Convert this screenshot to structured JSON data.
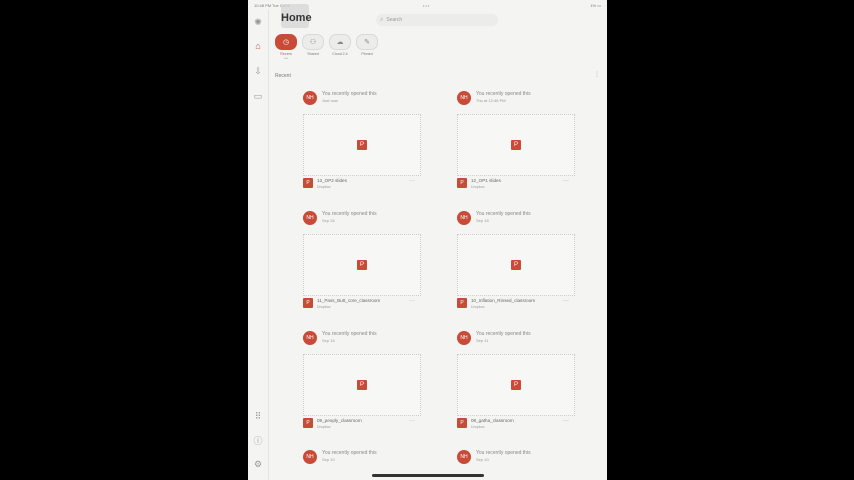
{
  "status_bar": {
    "time": "10:48 PM",
    "date": "Tue Oct 8",
    "dots": "• • •",
    "battery": "1% ▭"
  },
  "header": {
    "title": "Home",
    "search_placeholder": "Search"
  },
  "chips": [
    {
      "label": "Recent",
      "sub": "••••",
      "icon": "clock-icon",
      "active": true
    },
    {
      "label": "Shared",
      "sub": "",
      "icon": "people-icon",
      "active": false
    },
    {
      "label": "Cloud 2.4",
      "sub": "",
      "icon": "cloud-icon",
      "active": false
    },
    {
      "label": "Pinned",
      "sub": "",
      "icon": "pin-icon",
      "active": false
    }
  ],
  "section": {
    "title": "Recent"
  },
  "cards": [
    {
      "initials": "NH",
      "heading": "You recently opened this",
      "when": "Just now",
      "file": "13_OP2 slides",
      "location": "Dropbox"
    },
    {
      "initials": "NH",
      "heading": "You recently opened this",
      "when": "Thu at 12:48 PM",
      "file": "12_OP1 slides",
      "location": "Dropbox"
    },
    {
      "initials": "NH",
      "heading": "You recently opened this",
      "when": "Sep 26",
      "file": "11_Pass_Butt_core_classroom",
      "location": "Dropbox"
    },
    {
      "initials": "NH",
      "heading": "You recently opened this",
      "when": "Sep 18",
      "file": "10_Inflation_Rinsed_classroom",
      "location": "Dropbox"
    },
    {
      "initials": "NH",
      "heading": "You recently opened this",
      "when": "Sep 16",
      "file": "09_peoply_classroom",
      "location": "Dropbox"
    },
    {
      "initials": "NH",
      "heading": "You recently opened this",
      "when": "Sep 11",
      "file": "08_gatha_classroom",
      "location": "Dropbox"
    },
    {
      "initials": "NH",
      "heading": "You recently opened this",
      "when": "Sep 10",
      "file": "",
      "location": ""
    },
    {
      "initials": "NH",
      "heading": "You recently opened this",
      "when": "Sep 10",
      "file": "",
      "location": ""
    }
  ],
  "colors": {
    "accent": "#c94a37",
    "background": "#f4f4f3"
  }
}
